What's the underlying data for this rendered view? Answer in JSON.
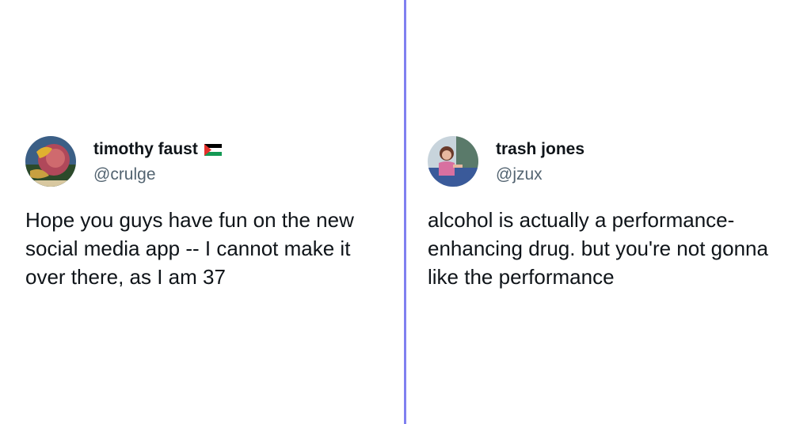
{
  "tweets": [
    {
      "display_name": "timothy faust",
      "handle": "@crulge",
      "flag_icon": "palestine-flag-icon",
      "text": "Hope you guys have fun on the new\nsocial media app -- I cannot make it\nover there, as I am 37"
    },
    {
      "display_name": "trash jones",
      "handle": "@jzux",
      "text": "alcohol is actually a performance-\nenhancing drug. but you're not gonna\nlike the performance"
    }
  ],
  "colors": {
    "divider": "#8080f0",
    "name": "#0f1419",
    "handle": "#536471"
  }
}
